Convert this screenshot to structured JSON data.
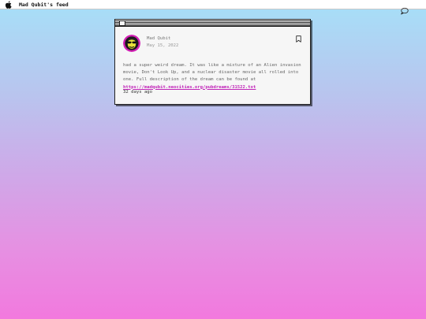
{
  "menubar": {
    "app_title": "Mad Qubit's feed",
    "left_icon": "apple-icon",
    "right_icon": "chat-bubble-icon"
  },
  "window": {
    "close_icon": "close-box-icon"
  },
  "post": {
    "avatar_icon": "avatar",
    "author": "Mad Qubit",
    "date": "May 15, 2022",
    "bookmark_icon": "bookmark-icon",
    "body_text": "had a super weird dream. It was like a mixture of an Alien invasion movie, Don't Look Up, and a nuclear disaster movie all rolled into one. Full description of the dream can be found at ",
    "link_text": "https://madqubit.neocities.org/pubdreams/31522.txt",
    "relative_time": "32 days ago"
  },
  "colors": {
    "link": "#c023b8",
    "gradient_top": "#a6e0f8",
    "gradient_bottom": "#f279de"
  }
}
